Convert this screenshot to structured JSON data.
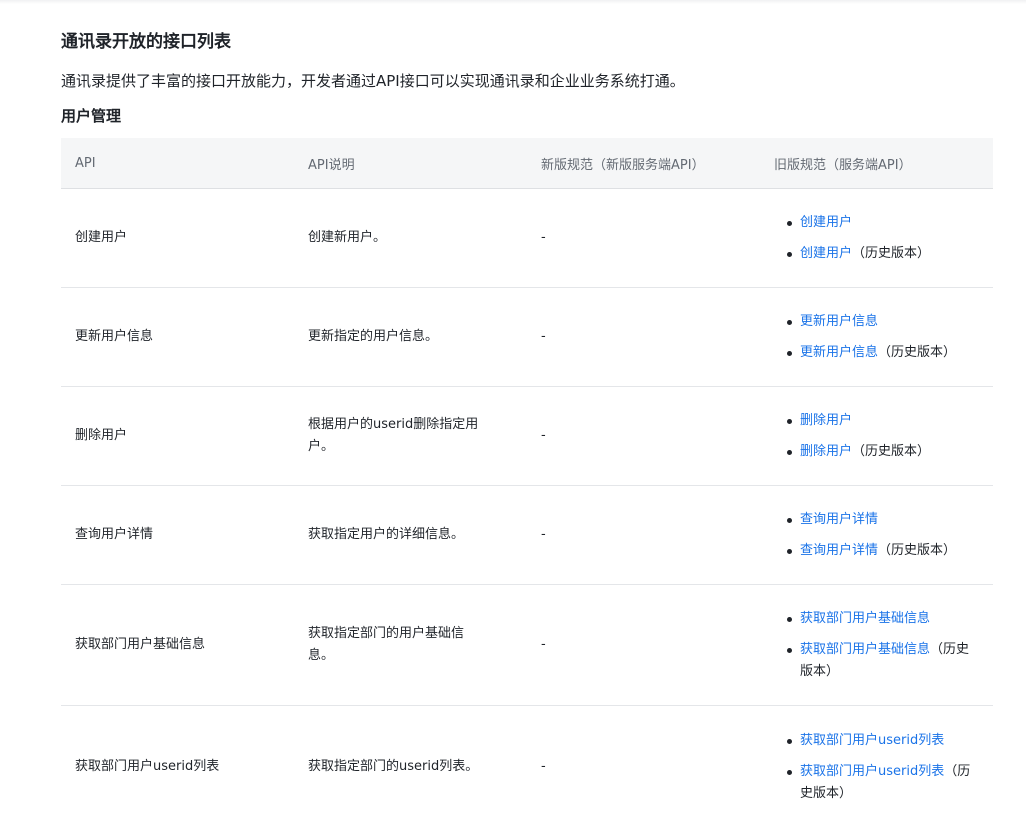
{
  "page": {
    "title": "通讯录开放的接口列表",
    "intro": "通讯录提供了丰富的接口开放能力，开发者通过API接口可以实现通讯录和企业业务系统打通。"
  },
  "section": {
    "title": "用户管理"
  },
  "table": {
    "headers": [
      "API",
      "API说明",
      "新版规范（新版服务端API）",
      "旧版规范（服务端API）"
    ],
    "rows": [
      {
        "api": "创建用户",
        "desc": "创建新用户。",
        "new_spec": "-",
        "legacy": [
          {
            "link": "创建用户",
            "suffix": ""
          },
          {
            "link": "创建用户",
            "suffix": "（历史版本）"
          }
        ]
      },
      {
        "api": "更新用户信息",
        "desc": "更新指定的用户信息。",
        "new_spec": "-",
        "legacy": [
          {
            "link": "更新用户信息",
            "suffix": ""
          },
          {
            "link": "更新用户信息",
            "suffix": "（历史版本）"
          }
        ]
      },
      {
        "api": "删除用户",
        "desc": "根据用户的userid删除指定用户。",
        "new_spec": "-",
        "legacy": [
          {
            "link": "删除用户",
            "suffix": ""
          },
          {
            "link": "删除用户",
            "suffix": "（历史版本）"
          }
        ]
      },
      {
        "api": "查询用户详情",
        "desc": "获取指定用户的详细信息。",
        "new_spec": "-",
        "legacy": [
          {
            "link": "查询用户详情",
            "suffix": ""
          },
          {
            "link": "查询用户详情",
            "suffix": "（历史版本）"
          }
        ]
      },
      {
        "api": "获取部门用户基础信息",
        "desc": "获取指定部门的用户基础信息。",
        "new_spec": "-",
        "legacy": [
          {
            "link": "获取部门用户基础信息",
            "suffix": ""
          },
          {
            "link": "获取部门用户基础信息",
            "suffix": "（历史版本）"
          }
        ]
      },
      {
        "api": "获取部门用户userid列表",
        "desc": "获取指定部门的userid列表。",
        "new_spec": "-",
        "legacy": [
          {
            "link": "获取部门用户userid列表",
            "suffix": ""
          },
          {
            "link": "获取部门用户userid列表",
            "suffix": "（历史版本）"
          }
        ]
      }
    ]
  }
}
